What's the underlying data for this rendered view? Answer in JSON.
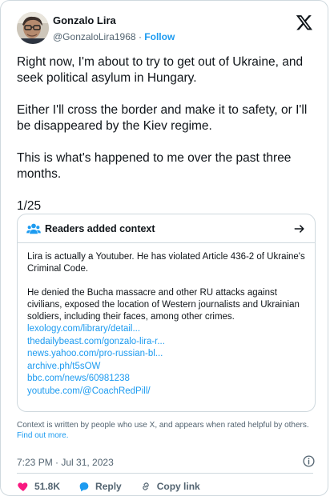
{
  "author": {
    "display_name": "Gonzalo Lira",
    "handle": "@GonzaloLira1968",
    "separator": "·",
    "follow_label": "Follow"
  },
  "tweet": {
    "paragraphs": [
      "Right now, I'm about to try to get out of Ukraine, and seek political asylum in Hungary.",
      "Either I'll cross the border and make it to safety, or I'll be disappeared by the Kiev regime.",
      "This is what's happened to me over the past three months.",
      "1/25"
    ]
  },
  "context": {
    "title": "Readers added context",
    "paragraphs": [
      "Lira is actually a Youtuber. He has violated Article 436-2 of Ukraine's Criminal Code.",
      "He denied the Bucha massacre and other RU attacks against civilians, exposed the location of Western journalists and Ukrainian soldiers, including their faces, among other crimes."
    ],
    "links": [
      "lexology.com/library/detail...",
      "thedailybeast.com/gonzalo-lira-r...",
      "news.yahoo.com/pro-russian-bl...",
      "archive.ph/t5sOW",
      "bbc.com/news/60981238",
      "youtube.com/@CoachRedPill/"
    ],
    "footer_text": "Context is written by people who use X, and appears when rated helpful by others.",
    "learn_more": "Find out more."
  },
  "meta": {
    "timestamp": "7:23 PM · Jul 31, 2023"
  },
  "actions": {
    "likes": "51.8K",
    "reply_label": "Reply",
    "copy_link_label": "Copy link"
  },
  "colors": {
    "accent": "#1d9bf0",
    "text": "#0f1419",
    "secondary": "#536471",
    "border": "#cfd9de",
    "like": "#f91880"
  }
}
